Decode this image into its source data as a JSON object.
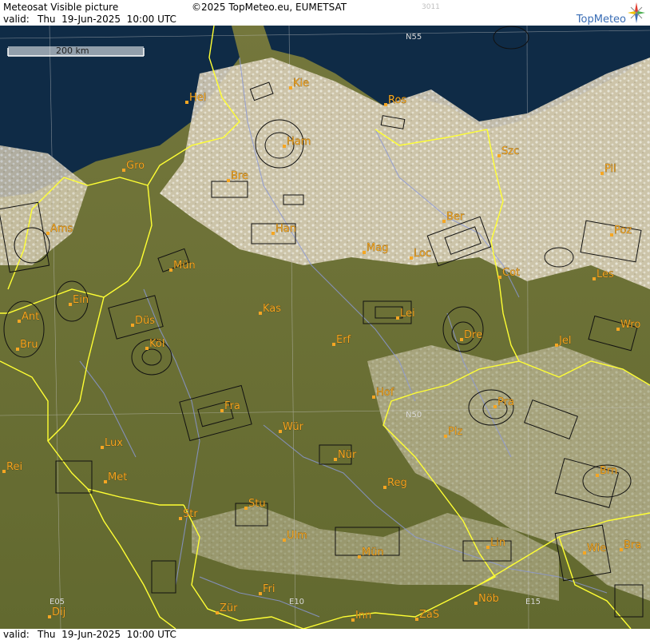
{
  "header": {
    "title": "Meteosat Visible picture",
    "copyright": "©2025 TopMeteo.eu, EUMETSAT",
    "image_code": "3011",
    "valid_prefix": "valid:",
    "valid_time": "Thu  19-Jun-2025  10:00 UTC",
    "brand": "TopMeteo"
  },
  "footer": {
    "valid_prefix": "valid:",
    "valid_time": "Thu  19-Jun-2025  10:00 UTC"
  },
  "scale_bar": {
    "label": "200 km"
  },
  "colors": {
    "land": "#6f7436",
    "sea": "#0e2a44",
    "cloud": "#e9e2d2",
    "border": "#ffff33",
    "river": "#8b98d8",
    "city_label": "#f5a623",
    "brand_blue": "#3a6db5"
  },
  "grid_labels": [
    "N55",
    "N50",
    "E05",
    "E10",
    "E15"
  ],
  "cities": [
    "Hel",
    "Kie",
    "Ros",
    "Ham",
    "Gro",
    "Bre",
    "Szc",
    "Pil",
    "Ber",
    "Ams",
    "Han",
    "Mag",
    "Loc",
    "Poz",
    "Mün",
    "Cot",
    "Les",
    "Ein",
    "Kas",
    "Lei",
    "Ant",
    "Düs",
    "Dre",
    "Wro",
    "Bru",
    "Köl",
    "Erf",
    "Jel",
    "Hof",
    "Fra",
    "Pra",
    "Wür",
    "Plz",
    "Lux",
    "Nür",
    "Rei",
    "Met",
    "Reg",
    "Brn",
    "Stu",
    "Str",
    "Ulm",
    "Mün",
    "Lin",
    "Wie",
    "Bra",
    "Fri",
    "Dij",
    "Zür",
    "Inn",
    "ZaS",
    "Nöb"
  ]
}
